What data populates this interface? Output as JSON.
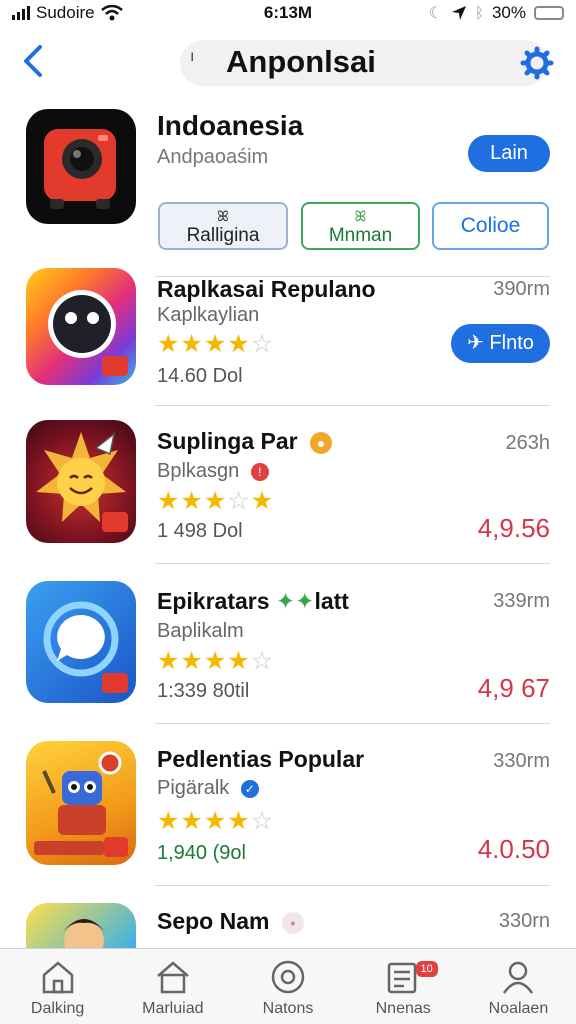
{
  "status": {
    "carrier": "Sudoire",
    "time": "6:13M",
    "battery": "30%",
    "battery_level": 0.6
  },
  "nav": {
    "title": "Anponlsai",
    "glyph": "ı"
  },
  "featured": {
    "name": "Indoanesia",
    "subtitle": "Andpaoaśim",
    "get_label": "Lain",
    "chips": [
      {
        "label": "Ralligina",
        "icon": "ꕤ"
      },
      {
        "label": "Mnman",
        "icon": "ꕤ"
      },
      {
        "label": "Colioe",
        "icon": ""
      }
    ]
  },
  "apps": [
    {
      "name": "Raplkasai Repulano",
      "subtitle": "Kaplkaylian",
      "stars": [
        true,
        true,
        true,
        true,
        false
      ],
      "rating": 4,
      "count": "14.60 Dol",
      "size": "390rm",
      "price": "",
      "action": "Flnto",
      "action_icon": "✈"
    },
    {
      "name": "Suplinga Par",
      "subtitle": "Bplkasgn",
      "stars": [
        true,
        true,
        true,
        false,
        true
      ],
      "rating": 3,
      "count": "1 498 Dol",
      "size": "263h",
      "price": "4,9.56",
      "action": "",
      "action_icon": ""
    },
    {
      "name": "Epikratars",
      "name_suffix": "latt",
      "subtitle": "Baplikalm",
      "stars": [
        true,
        true,
        true,
        true,
        false
      ],
      "rating": 4,
      "count": "1:339 80til",
      "size": "339rm",
      "price": "4,9 67",
      "action": "",
      "action_icon": ""
    },
    {
      "name": "Pedlentias Popular",
      "subtitle": "Pigäralk",
      "stars": [
        true,
        true,
        true,
        true,
        false
      ],
      "rating": 4,
      "count": "1,940 (9ol",
      "size": "330rm",
      "price": "4.0.50",
      "action": "",
      "action_icon": ""
    },
    {
      "name": "Sepo Nam",
      "subtitle": "",
      "stars": [],
      "rating": null,
      "count": "",
      "size": "330rn",
      "price": "",
      "action": "",
      "action_icon": ""
    }
  ],
  "tabs": [
    {
      "label": "Dalking",
      "icon": "home-icon"
    },
    {
      "label": "Marluiad",
      "icon": "house-icon"
    },
    {
      "label": "Natons",
      "icon": "disc-icon"
    },
    {
      "label": "Nnenas",
      "icon": "news-icon",
      "badge": "10"
    },
    {
      "label": "Noalaen",
      "icon": "person-icon"
    }
  ],
  "colors": {
    "accent": "#1f6fe0",
    "price": "#d2374a",
    "star": "#f5b800"
  }
}
